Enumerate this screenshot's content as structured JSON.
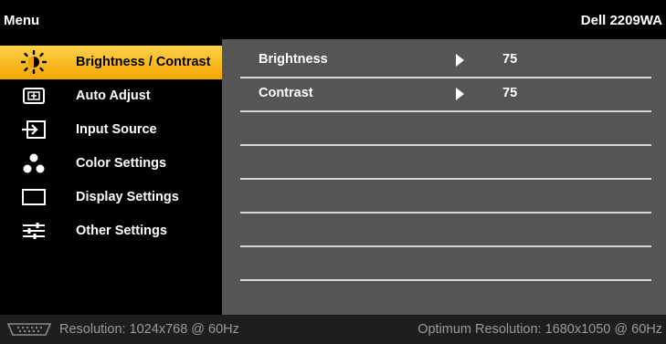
{
  "header": {
    "title": "Menu",
    "model": "Dell 2209WA"
  },
  "sidebar": {
    "items": [
      {
        "label": "Brightness / Contrast",
        "icon": "sun-icon",
        "active": true
      },
      {
        "label": "Auto Adjust",
        "icon": "auto-adjust-icon",
        "active": false
      },
      {
        "label": "Input Source",
        "icon": "input-source-icon",
        "active": false
      },
      {
        "label": "Color Settings",
        "icon": "color-dots-icon",
        "active": false
      },
      {
        "label": "Display Settings",
        "icon": "display-rectangle-icon",
        "active": false
      },
      {
        "label": "Other Settings",
        "icon": "sliders-icon",
        "active": false
      }
    ]
  },
  "content": {
    "rows": [
      {
        "label": "Brightness",
        "value": "75"
      },
      {
        "label": "Contrast",
        "value": "75"
      },
      {
        "label": "",
        "value": ""
      },
      {
        "label": "",
        "value": ""
      },
      {
        "label": "",
        "value": ""
      },
      {
        "label": "",
        "value": ""
      }
    ]
  },
  "status": {
    "resolution": "Resolution: 1024x768 @ 60Hz",
    "optimum": "Optimum Resolution: 1680x1050 @ 60Hz",
    "connector_icon": "vga-connector-icon"
  },
  "colors": {
    "accent": "#f3a600",
    "panel": "#555555",
    "background": "#000000"
  }
}
